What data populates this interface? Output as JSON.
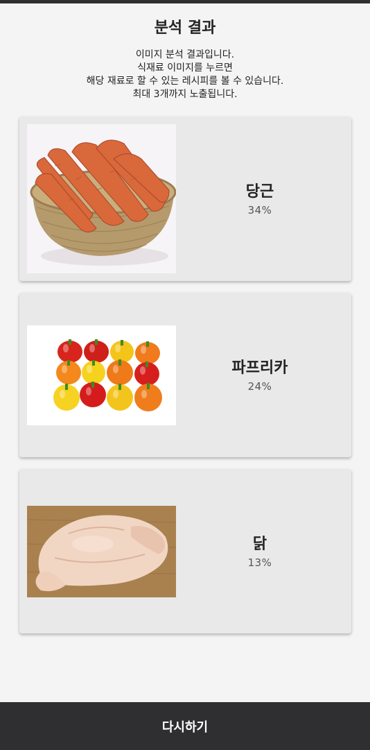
{
  "page": {
    "title": "분석 결과",
    "description_lines": [
      "이미지 분석 결과입니다.",
      "식재료 이미지를 누르면",
      "해당 재료로 할 수 있는 레시피를 볼 수 있습니다.",
      "최대 3개까지 노출됩니다."
    ]
  },
  "results": [
    {
      "name": "당근",
      "percent": "34%",
      "image": "carrots-in-basket"
    },
    {
      "name": "파프리카",
      "percent": "24%",
      "image": "paprika-peppers"
    },
    {
      "name": "닭",
      "percent": "13%",
      "image": "raw-chicken"
    }
  ],
  "footer": {
    "retry_label": "다시하기"
  },
  "colors": {
    "bar": "#2f2f31",
    "card": "#e9e9e9",
    "background": "#f4f4f4"
  }
}
